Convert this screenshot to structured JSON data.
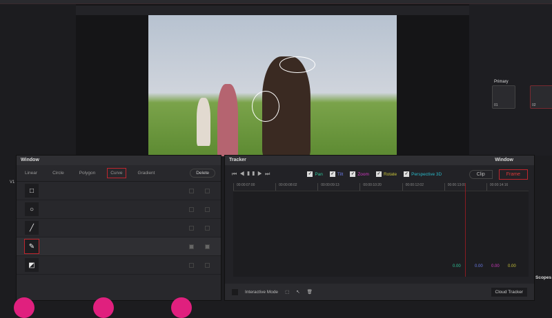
{
  "window_panel": {
    "title": "Window",
    "tools": [
      {
        "label": "Linear",
        "icon": "linear-window-icon"
      },
      {
        "label": "Circle",
        "icon": "circle-window-icon"
      },
      {
        "label": "Polygon",
        "icon": "polygon-window-icon"
      },
      {
        "label": "Curve",
        "icon": "curve-window-icon",
        "selected": true
      },
      {
        "label": "Gradient",
        "icon": "gradient-window-icon"
      }
    ],
    "delete_label": "Delete",
    "shapes": [
      "□",
      "○",
      "╱",
      "✎",
      "◩"
    ]
  },
  "tracker": {
    "title": "Tracker",
    "mode_label": "Window",
    "checks": [
      {
        "label": "Pan",
        "color": "#2fc79a"
      },
      {
        "label": "Tilt",
        "color": "#6c7be8"
      },
      {
        "label": "Zoom",
        "color": "#d43ac4"
      },
      {
        "label": "Rotate",
        "color": "#c9c43a"
      },
      {
        "label": "Perspective 3D",
        "color": "#2ab8c8"
      }
    ],
    "clip_label": "Clip",
    "frame_label": "Frame",
    "timecodes": [
      "00:00:07:00",
      "00:00:08:02",
      "00:00:09:13",
      "00:00:10:20",
      "00:00:12:02",
      "00:00:13:09",
      "00:00:14:16"
    ],
    "values": [
      {
        "v": "0.00",
        "color": "#2fc79a"
      },
      {
        "v": "0.00",
        "color": "#6c7be8"
      },
      {
        "v": "0.00",
        "color": "#d43ac4"
      },
      {
        "v": "0.00",
        "color": "#c9c43a"
      }
    ],
    "interactive_mode": "Interactive Mode",
    "cloud_tracker": "Cloud Tracker"
  },
  "nodes": {
    "primary": "Primary",
    "n1": "01",
    "n2": "02"
  },
  "side": {
    "scopes": "Scopes",
    "track": "V1"
  }
}
